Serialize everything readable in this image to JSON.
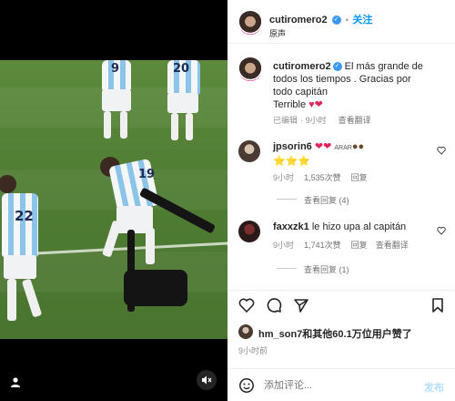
{
  "media": {
    "jersey_numbers": [
      "9",
      "20",
      "19",
      "22"
    ]
  },
  "post": {
    "author": "cutiromero2",
    "follow_label": "关注",
    "audio_label": "原声",
    "caption_lines": [
      "El más grande de",
      "todos los tiempos . Gracias por",
      "todo capitán",
      "Terrible"
    ],
    "caption_emoji": "♥❤",
    "edited_label": "已编辑",
    "time": "9小时",
    "translate_label": "查看翻译"
  },
  "comments": [
    {
      "user": "jpsorin6",
      "text_emoji": "❤❤",
      "text_extra": "ARAR",
      "line2_emoji": "⭐⭐⭐",
      "time": "9小时",
      "likes": "1,535次赞",
      "reply_label": "回复",
      "replies_label": "查看回复 (4)"
    },
    {
      "user": "faxxzk1",
      "text": "le hizo upa al capitán",
      "time": "9小时",
      "likes": "1,741次赞",
      "reply_label": "回复",
      "translate_label": "查看翻译",
      "replies_label": "查看回复 (1)"
    }
  ],
  "likes": {
    "summary": "hm_son7和其他60.1万位用户赞了",
    "time": "9小时前"
  },
  "composer": {
    "placeholder": "添加评论...",
    "post_label": "发布"
  },
  "colors": {
    "link_blue": "#0095f6",
    "verified_blue": "#3897f0",
    "heart_red": "#e0245e",
    "muted_gray": "#8e8e8e"
  }
}
